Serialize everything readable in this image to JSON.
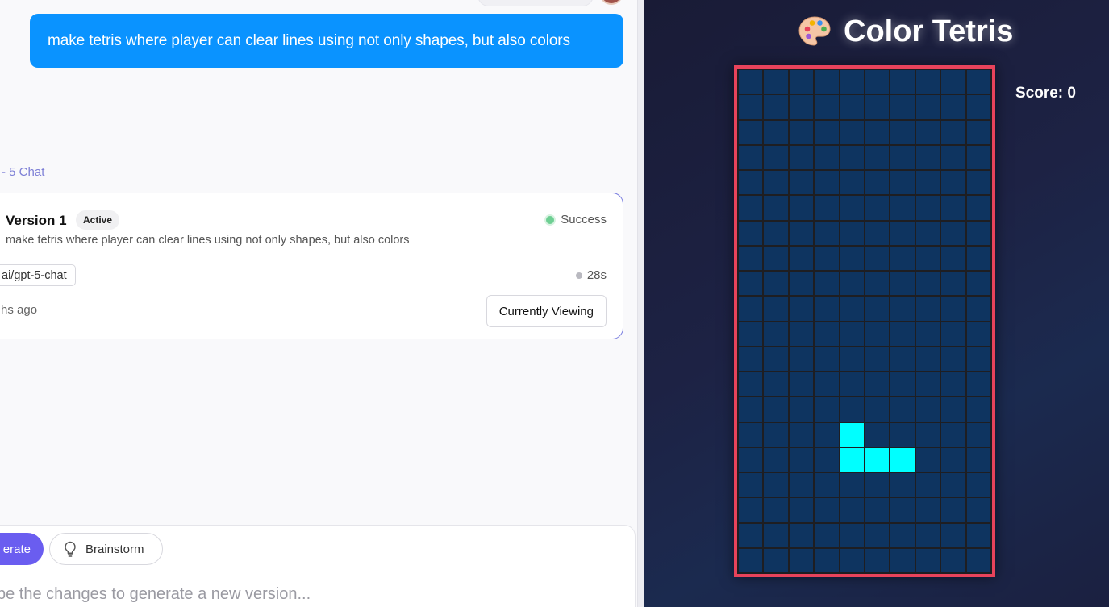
{
  "chat": {
    "user_message": "make tetris where player can clear lines using not only shapes, but also colors",
    "model_label": "- 5 Chat",
    "version_card": {
      "title": "Version 1",
      "badge": "Active",
      "status": "Success",
      "description": "make tetris where player can clear lines using not only shapes, but also colors",
      "model_tag": "ai/gpt-5-chat",
      "duration": "28s",
      "time_ago": "hs ago",
      "viewing_button": "Currently Viewing"
    },
    "composer": {
      "generate_label": "erate",
      "brainstorm_label": "Brainstorm",
      "placeholder": "be the changes to generate a new version..."
    }
  },
  "game": {
    "title": "Color Tetris",
    "title_icon": "palette-icon",
    "score_label": "Score: 0",
    "board": {
      "columns": 10,
      "rows": 20,
      "empty_color": "#0e3460",
      "border_color": "#e8435b",
      "active_piece": {
        "color": "#00ffff",
        "cells": [
          [
            4,
            14
          ],
          [
            4,
            15
          ],
          [
            5,
            15
          ],
          [
            6,
            15
          ]
        ]
      }
    }
  }
}
